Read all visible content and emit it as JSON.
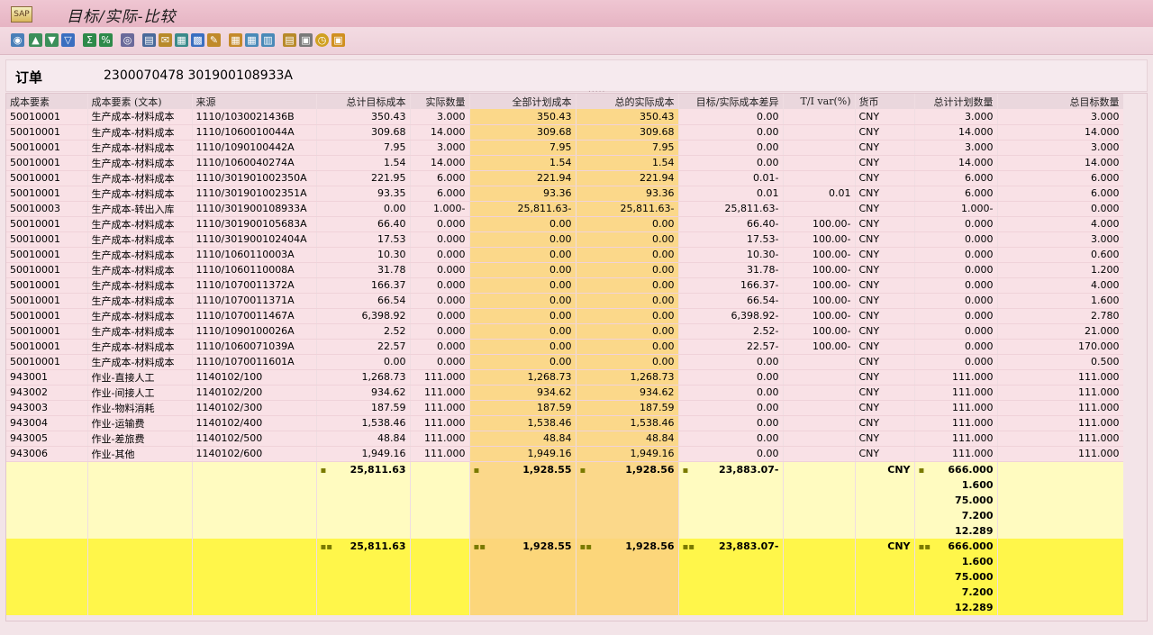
{
  "window": {
    "title": "目标/实际-比较",
    "app_icon_label": "SAP"
  },
  "order": {
    "label": "订单",
    "value": "2300070478 301900108933A",
    "grip": "....."
  },
  "columns": [
    "成本要素",
    "成本要素 (文本)",
    "来源",
    "总计目标成本",
    "实际数量",
    "全部计划成本",
    "总的实际成本",
    "目标/实际成本差异",
    "T/I var(%)",
    "货币",
    "总计计划数量",
    "总目标数量"
  ],
  "rows": [
    [
      "50010001",
      "生产成本-材料成本",
      "1110/1030021436B",
      "350.43",
      "3.000",
      "350.43",
      "350.43",
      "0.00",
      "",
      "CNY",
      "3.000",
      "3.000"
    ],
    [
      "50010001",
      "生产成本-材料成本",
      "1110/1060010044A",
      "309.68",
      "14.000",
      "309.68",
      "309.68",
      "0.00",
      "",
      "CNY",
      "14.000",
      "14.000"
    ],
    [
      "50010001",
      "生产成本-材料成本",
      "1110/1090100442A",
      "7.95",
      "3.000",
      "7.95",
      "7.95",
      "0.00",
      "",
      "CNY",
      "3.000",
      "3.000"
    ],
    [
      "50010001",
      "生产成本-材料成本",
      "1110/1060040274A",
      "1.54",
      "14.000",
      "1.54",
      "1.54",
      "0.00",
      "",
      "CNY",
      "14.000",
      "14.000"
    ],
    [
      "50010001",
      "生产成本-材料成本",
      "1110/301901002350A",
      "221.95",
      "6.000",
      "221.94",
      "221.94",
      "0.01-",
      "",
      "CNY",
      "6.000",
      "6.000"
    ],
    [
      "50010001",
      "生产成本-材料成本",
      "1110/301901002351A",
      "93.35",
      "6.000",
      "93.36",
      "93.36",
      "0.01",
      "0.01",
      "CNY",
      "6.000",
      "6.000"
    ],
    [
      "50010003",
      "生产成本-转出入库",
      "1110/301900108933A",
      "0.00",
      "1.000-",
      "25,811.63-",
      "25,811.63-",
      "25,811.63-",
      "",
      "CNY",
      "1.000-",
      "0.000"
    ],
    [
      "50010001",
      "生产成本-材料成本",
      "1110/301900105683A",
      "66.40",
      "0.000",
      "0.00",
      "0.00",
      "66.40-",
      "100.00-",
      "CNY",
      "0.000",
      "4.000"
    ],
    [
      "50010001",
      "生产成本-材料成本",
      "1110/301900102404A",
      "17.53",
      "0.000",
      "0.00",
      "0.00",
      "17.53-",
      "100.00-",
      "CNY",
      "0.000",
      "3.000"
    ],
    [
      "50010001",
      "生产成本-材料成本",
      "1110/1060110003A",
      "10.30",
      "0.000",
      "0.00",
      "0.00",
      "10.30-",
      "100.00-",
      "CNY",
      "0.000",
      "0.600"
    ],
    [
      "50010001",
      "生产成本-材料成本",
      "1110/1060110008A",
      "31.78",
      "0.000",
      "0.00",
      "0.00",
      "31.78-",
      "100.00-",
      "CNY",
      "0.000",
      "1.200"
    ],
    [
      "50010001",
      "生产成本-材料成本",
      "1110/1070011372A",
      "166.37",
      "0.000",
      "0.00",
      "0.00",
      "166.37-",
      "100.00-",
      "CNY",
      "0.000",
      "4.000"
    ],
    [
      "50010001",
      "生产成本-材料成本",
      "1110/1070011371A",
      "66.54",
      "0.000",
      "0.00",
      "0.00",
      "66.54-",
      "100.00-",
      "CNY",
      "0.000",
      "1.600"
    ],
    [
      "50010001",
      "生产成本-材料成本",
      "1110/1070011467A",
      "6,398.92",
      "0.000",
      "0.00",
      "0.00",
      "6,398.92-",
      "100.00-",
      "CNY",
      "0.000",
      "2.780"
    ],
    [
      "50010001",
      "生产成本-材料成本",
      "1110/1090100026A",
      "2.52",
      "0.000",
      "0.00",
      "0.00",
      "2.52-",
      "100.00-",
      "CNY",
      "0.000",
      "21.000"
    ],
    [
      "50010001",
      "生产成本-材料成本",
      "1110/1060071039A",
      "22.57",
      "0.000",
      "0.00",
      "0.00",
      "22.57-",
      "100.00-",
      "CNY",
      "0.000",
      "170.000"
    ],
    [
      "50010001",
      "生产成本-材料成本",
      "1110/1070011601A",
      "0.00",
      "0.000",
      "0.00",
      "0.00",
      "0.00",
      "",
      "CNY",
      "0.000",
      "0.500"
    ],
    [
      "943001",
      "作业-直接人工",
      "1140102/100",
      "1,268.73",
      "111.000",
      "1,268.73",
      "1,268.73",
      "0.00",
      "",
      "CNY",
      "111.000",
      "111.000"
    ],
    [
      "943002",
      "作业-间接人工",
      "1140102/200",
      "934.62",
      "111.000",
      "934.62",
      "934.62",
      "0.00",
      "",
      "CNY",
      "111.000",
      "111.000"
    ],
    [
      "943003",
      "作业-物料消耗",
      "1140102/300",
      "187.59",
      "111.000",
      "187.59",
      "187.59",
      "0.00",
      "",
      "CNY",
      "111.000",
      "111.000"
    ],
    [
      "943004",
      "作业-运输费",
      "1140102/400",
      "1,538.46",
      "111.000",
      "1,538.46",
      "1,538.46",
      "0.00",
      "",
      "CNY",
      "111.000",
      "111.000"
    ],
    [
      "943005",
      "作业-差旅费",
      "1140102/500",
      "48.84",
      "111.000",
      "48.84",
      "48.84",
      "0.00",
      "",
      "CNY",
      "111.000",
      "111.000"
    ],
    [
      "943006",
      "作业-其他",
      "1140102/600",
      "1,949.16",
      "111.000",
      "1,949.16",
      "1,949.16",
      "0.00",
      "",
      "CNY",
      "111.000",
      "111.000"
    ]
  ],
  "subtotal": {
    "marker": "▪",
    "target": "25,811.63",
    "plan": "1,928.55",
    "actual": "1,928.56",
    "variance": "23,883.07-",
    "currency": "CNY",
    "plan_qty": [
      "666.000",
      "1.600",
      "75.000",
      "7.200",
      "12.289"
    ]
  },
  "total": {
    "marker": "▪▪",
    "target": "25,811.63",
    "plan": "1,928.55",
    "actual": "1,928.56",
    "variance": "23,883.07-",
    "currency": "CNY",
    "plan_qty": [
      "666.000",
      "1.600",
      "75.000",
      "7.200",
      "12.289"
    ]
  }
}
